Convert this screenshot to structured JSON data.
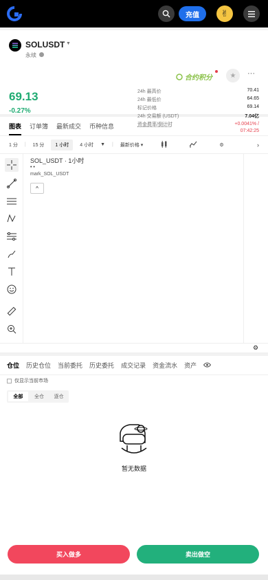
{
  "header": {
    "deposit_label": "充值",
    "avatar_emoji": "✌"
  },
  "ticker": {
    "symbol": "SOLUSDT",
    "perp_label": "永续",
    "price": "69.13",
    "change": "-0.27%",
    "points_label": "合约积分",
    "stats": [
      {
        "k": "24h 最高价",
        "v": "70.41"
      },
      {
        "k": "24h 最低价",
        "v": "64.65"
      },
      {
        "k": "标记价格",
        "v": "69.14"
      },
      {
        "k": "24h 交易额 (USDT)",
        "v": "7.04亿"
      }
    ],
    "funding_label": "资金费率/倒计时",
    "funding_rate": "+0.0041% /",
    "countdown": "07:42:25"
  },
  "tabs": [
    "图表",
    "订单簿",
    "最新成交",
    "币种信息"
  ],
  "toolbar": {
    "intervals": [
      "1 分",
      "15 分",
      "1 小时",
      "4 小时"
    ],
    "selected": "1 小时",
    "latest_price_label": "最新价格"
  },
  "chart": {
    "title": "SOL_USDT · 1小时",
    "dots": "• •",
    "mark": "mark_SOL_USDT"
  },
  "positions": {
    "tabs": [
      "仓位",
      "历史仓位",
      "当前委托",
      "历史委托",
      "成交记录",
      "资金流水",
      "资产"
    ],
    "filter_label": "仅显示当前市场",
    "segments": [
      "全部",
      "全仓",
      "逐仓"
    ],
    "empty_text": "暂无数据"
  },
  "actions": {
    "buy_label": "买入做多",
    "sell_label": "卖出做空"
  }
}
